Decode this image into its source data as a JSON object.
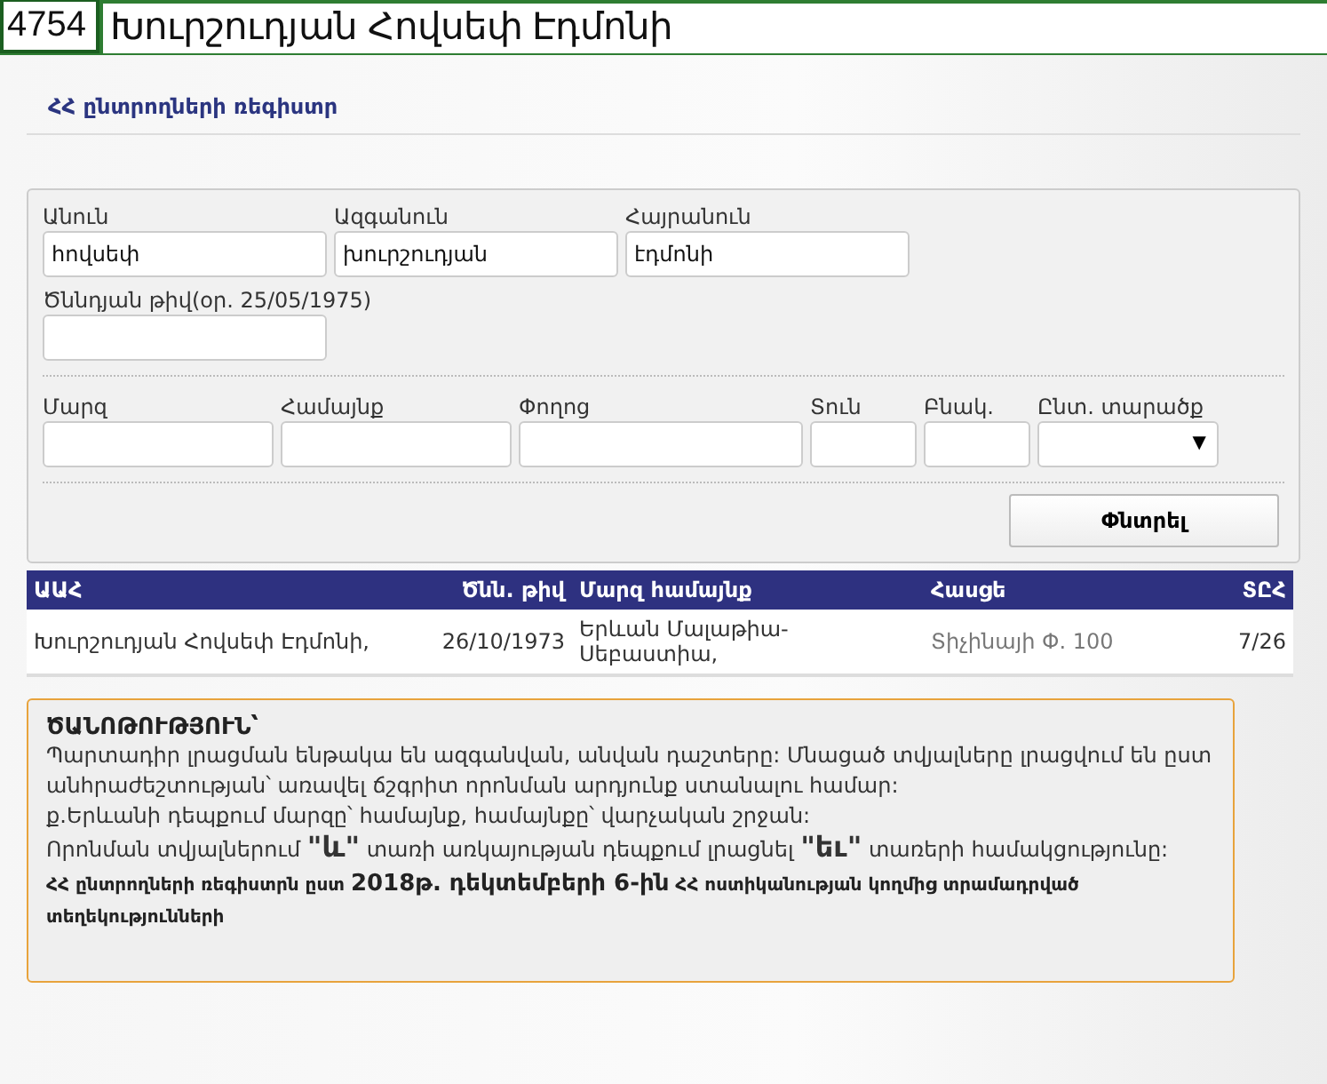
{
  "top_bar": {
    "number": "4754",
    "name": "Խուրշուդյան Հովսեփ Էդմոնի"
  },
  "title": "ՀՀ ընտրողների ռեգիստր",
  "form": {
    "row1": [
      {
        "label": "Անուն",
        "value": "հովսեփ"
      },
      {
        "label": "Ազգանուն",
        "value": "խուրշուդյան"
      },
      {
        "label": "Հայրանուն",
        "value": "էդմոնի"
      }
    ],
    "row2": [
      {
        "label": "Ծննդյան թիվ(օր. 25/05/1975)"
      }
    ],
    "row3": [
      {
        "label": "Մարզ",
        "kind": "input"
      },
      {
        "label": "Համայնք",
        "kind": "input"
      },
      {
        "label": "Փողոց",
        "kind": "input"
      },
      {
        "label": "Տուն",
        "kind": "input"
      },
      {
        "label": "Բնակ.",
        "kind": "input"
      },
      {
        "label": "Ընտ. տարածք",
        "kind": "select",
        "arrow": "▼"
      }
    ],
    "search_button": "Փնտրել"
  },
  "table": {
    "columns": [
      "ԱԱՀ",
      "Ծնն. թիվ",
      "Մարզ համայնք",
      "Հասցե",
      "ՏԸՀ"
    ],
    "rows": [
      [
        "Խուրշուդյան Հովսեփ Էդմոնի,",
        "26/10/1973",
        "Երևան Մալաթիա-Սեբաստիա,",
        "Տիչինայի Փ. 100",
        "7/26"
      ]
    ]
  },
  "note": {
    "heading": "ԾԱՆՈԹՈՒԹՅՈՒՆ՝",
    "lines": [
      {
        "kind": "text",
        "text": "Պարտադիր լրացման ենթակա են ազգանվան, անվան դաշտերը: Մնացած տվյալները լրացվում են ըստ անհրաժեշտության՝ առավել ճշգրիտ որոնման արդյունք ստանալու համար:"
      },
      {
        "kind": "text",
        "text": "ք.Երևանի դեպքում մարզը՝ համայնք, համայնքը՝ վարչական շրջան:"
      },
      {
        "kind": "text",
        "text": "Որոնման տվյալներում **\"և\"** տառի առկայության դեպքում լրացնել **\"եւ\"** տառերի համակցությունը:"
      },
      {
        "kind": "footer",
        "text": "ՀՀ ընտրողների ռեգիստրն ըստ **2018թ. դեկտեմբերի 6-ին** ՀՀ ոստիկանության կողմից տրամադրված տեղեկությունների"
      }
    ]
  }
}
